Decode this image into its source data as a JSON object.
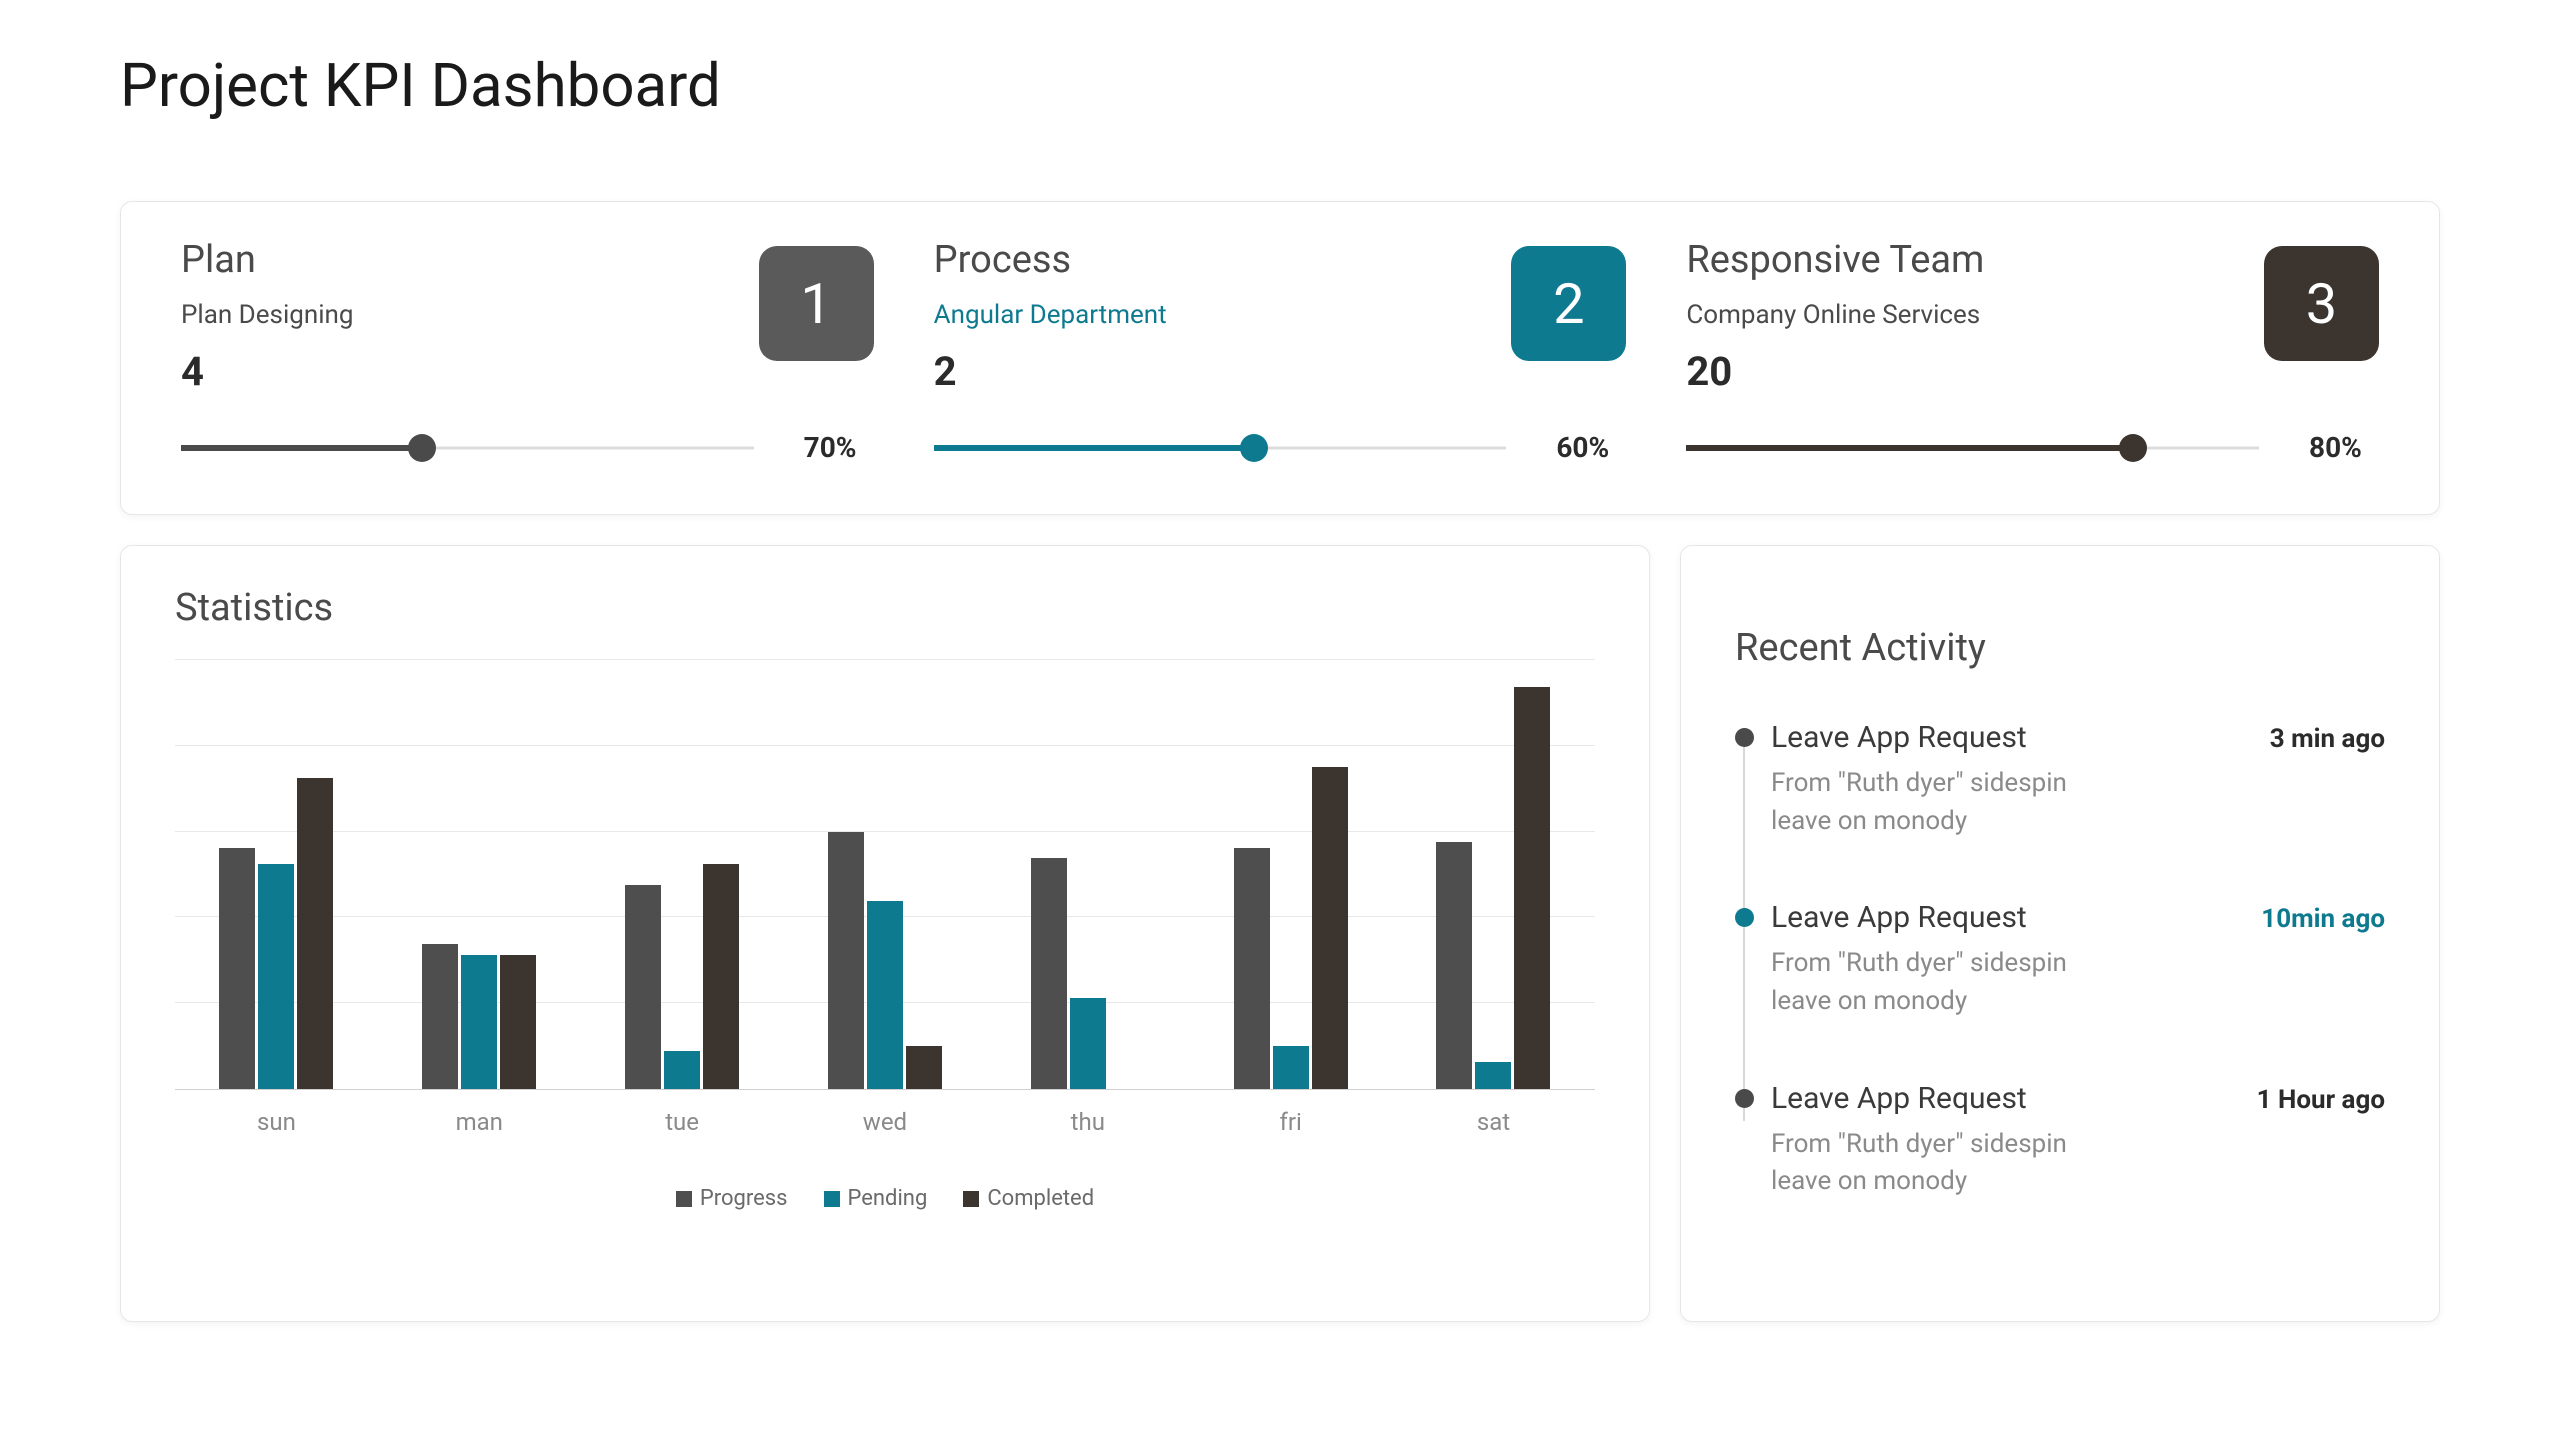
{
  "page_title": "Project KPI Dashboard",
  "kpis": [
    {
      "title": "Plan",
      "subtitle": "Plan Designing",
      "value": "4",
      "badge": "1",
      "badge_style": "gray",
      "sub_style": "",
      "percent": 70,
      "percent_label": "70%",
      "slider_pos": 42,
      "slider_style": "gray"
    },
    {
      "title": "Process",
      "subtitle": "Angular Department",
      "value": "2",
      "badge": "2",
      "badge_style": "teal",
      "sub_style": "teal",
      "percent": 60,
      "percent_label": "60%",
      "slider_pos": 56,
      "slider_style": "teal"
    },
    {
      "title": "Responsive Team",
      "subtitle": "Company Online Services",
      "value": "20",
      "badge": "3",
      "badge_style": "dark",
      "sub_style": "",
      "percent": 80,
      "percent_label": "80%",
      "slider_pos": 78,
      "slider_style": "dark"
    }
  ],
  "statistics": {
    "title": "Statistics"
  },
  "chart_data": {
    "type": "bar",
    "categories": [
      "sun",
      "man",
      "tue",
      "wed",
      "thu",
      "fri",
      "sat"
    ],
    "series": [
      {
        "name": "Progress",
        "values": [
          45,
          27,
          38,
          48,
          43,
          45,
          46
        ]
      },
      {
        "name": "Pending",
        "values": [
          42,
          25,
          7,
          35,
          17,
          8,
          5
        ]
      },
      {
        "name": "Completed",
        "values": [
          58,
          25,
          42,
          8,
          0,
          60,
          75
        ]
      }
    ],
    "ylim": [
      0,
      80
    ],
    "gridlines": 5,
    "legend_position": "bottom",
    "title": "",
    "xlabel": "",
    "ylabel": ""
  },
  "recent_activity": {
    "title": "Recent Activity",
    "items": [
      {
        "title": "Leave App Request",
        "desc": "From \"Ruth dyer\" sidespin leave on monody",
        "time": "3 min ago",
        "dot": "gray",
        "time_style": ""
      },
      {
        "title": "Leave App Request",
        "desc": "From \"Ruth dyer\" sidespin leave on monody",
        "time": "10min ago",
        "dot": "teal",
        "time_style": "teal"
      },
      {
        "title": "Leave App Request",
        "desc": "From \"Ruth dyer\" sidespin leave on monody",
        "time": "1 Hour ago",
        "dot": "gray",
        "time_style": ""
      }
    ]
  }
}
